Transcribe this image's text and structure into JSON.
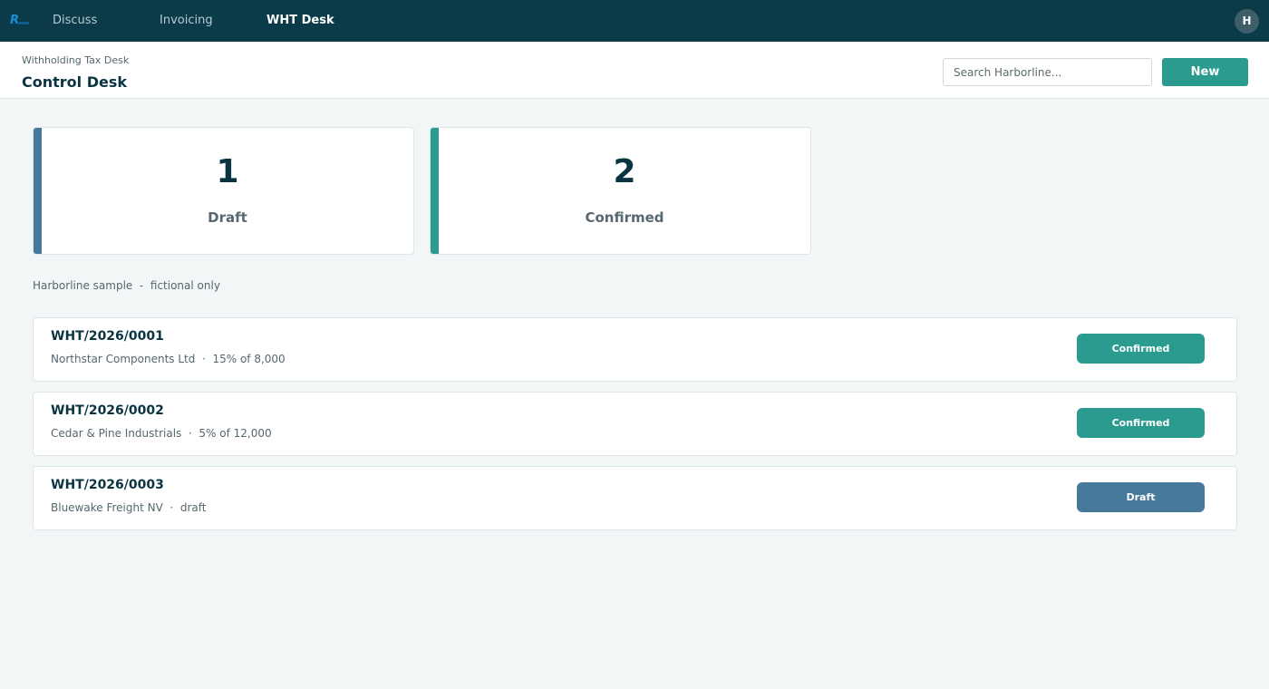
{
  "nav": {
    "items": [
      {
        "label": "Discuss"
      },
      {
        "label": "Invoicing"
      },
      {
        "label": "WHT Desk"
      }
    ],
    "avatar": "H"
  },
  "header": {
    "breadcrumb": "Withholding Tax Desk",
    "title": "Control Desk",
    "search_placeholder": "Search Harborline...",
    "new_label": "New"
  },
  "stats": [
    {
      "value": "1",
      "label": "Draft",
      "color": "#46799a"
    },
    {
      "value": "2",
      "label": "Confirmed",
      "color": "#2a9b8e"
    }
  ],
  "note": "Harborline sample  -  fictional only",
  "records": [
    {
      "id": "WHT/2026/0001",
      "party": "Northstar Components Ltd",
      "detail": "15% of 8,000",
      "status": "Confirmed",
      "status_color": "#2a9b8e"
    },
    {
      "id": "WHT/2026/0002",
      "party": "Cedar & Pine Industrials",
      "detail": "5% of 12,000",
      "status": "Confirmed",
      "status_color": "#2a9b8e"
    },
    {
      "id": "WHT/2026/0003",
      "party": "Bluewake Freight NV",
      "detail": "draft",
      "status": "Draft",
      "status_color": "#46799a"
    }
  ]
}
